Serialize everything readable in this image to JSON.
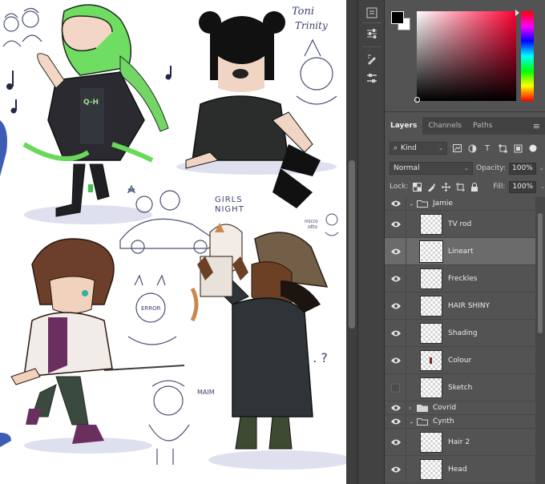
{
  "tabs": [
    {
      "label": "Layers",
      "active": true
    },
    {
      "label": "Channels",
      "active": false
    },
    {
      "label": "Paths",
      "active": false
    }
  ],
  "filter": {
    "kind": "Kind"
  },
  "blend": {
    "mode": "Normal",
    "opacity_label": "Opacity:",
    "opacity": "100%"
  },
  "lock": {
    "label": "Lock:",
    "fill_label": "Fill:",
    "fill": "100%"
  },
  "layers": [
    {
      "name": "Jamie",
      "type": "group",
      "visible": true,
      "expanded": true
    },
    {
      "name": "TV rod",
      "type": "layer",
      "visible": true
    },
    {
      "name": "Lineart",
      "type": "layer",
      "visible": true,
      "selected": true
    },
    {
      "name": "Freckles",
      "type": "layer",
      "visible": true
    },
    {
      "name": "HAIR SHINY",
      "type": "layer",
      "visible": true
    },
    {
      "name": "Shading",
      "type": "layer",
      "visible": true
    },
    {
      "name": "Colour",
      "type": "layer",
      "visible": true
    },
    {
      "name": "Sketch",
      "type": "layer",
      "visible": false
    },
    {
      "name": "Covrid",
      "type": "group",
      "visible": true,
      "expanded": false
    },
    {
      "name": "Cynth",
      "type": "group",
      "visible": true,
      "expanded": true
    },
    {
      "name": "Hair 2",
      "type": "layer",
      "visible": true
    },
    {
      "name": "Head",
      "type": "layer",
      "visible": true
    }
  ],
  "canvas_text": {
    "toni": "Toni",
    "trinity": "Trinity",
    "girls": "GIRLS",
    "night": "NIGHT",
    "error": "ERROR",
    "micro": "micro",
    "otto": "otto",
    "maim": "MAIM",
    "question": ". . ?"
  },
  "colors": {
    "foreground": "#000000",
    "background": "#ffffff",
    "panel": "#535353",
    "selected_layer": "#6b6b6b"
  }
}
